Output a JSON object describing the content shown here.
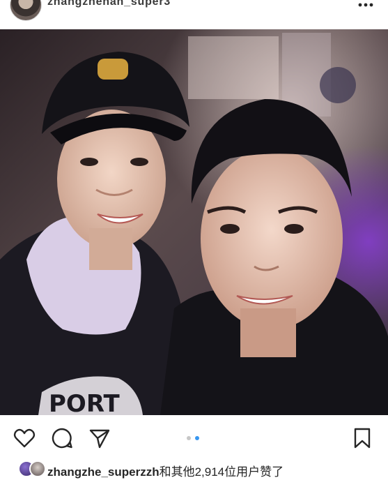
{
  "post": {
    "username": "zhangzhenan_super3",
    "more_icon": "more-horizontal-icon"
  },
  "photo": {
    "icon": "photo"
  },
  "actions": {
    "icons": [
      "heart-icon",
      "comment-icon",
      "share-icon",
      "bookmark-icon"
    ],
    "carousel_pages": 2,
    "carousel_active": 2
  },
  "likes": {
    "liker_name": "zhangzhe_superzzh",
    "rest_text": "和其他2,914位用户赞了"
  },
  "colors": {
    "active_dot": "#3897f0",
    "inactive_dot": "#c7c7c7",
    "text": "#262626"
  }
}
